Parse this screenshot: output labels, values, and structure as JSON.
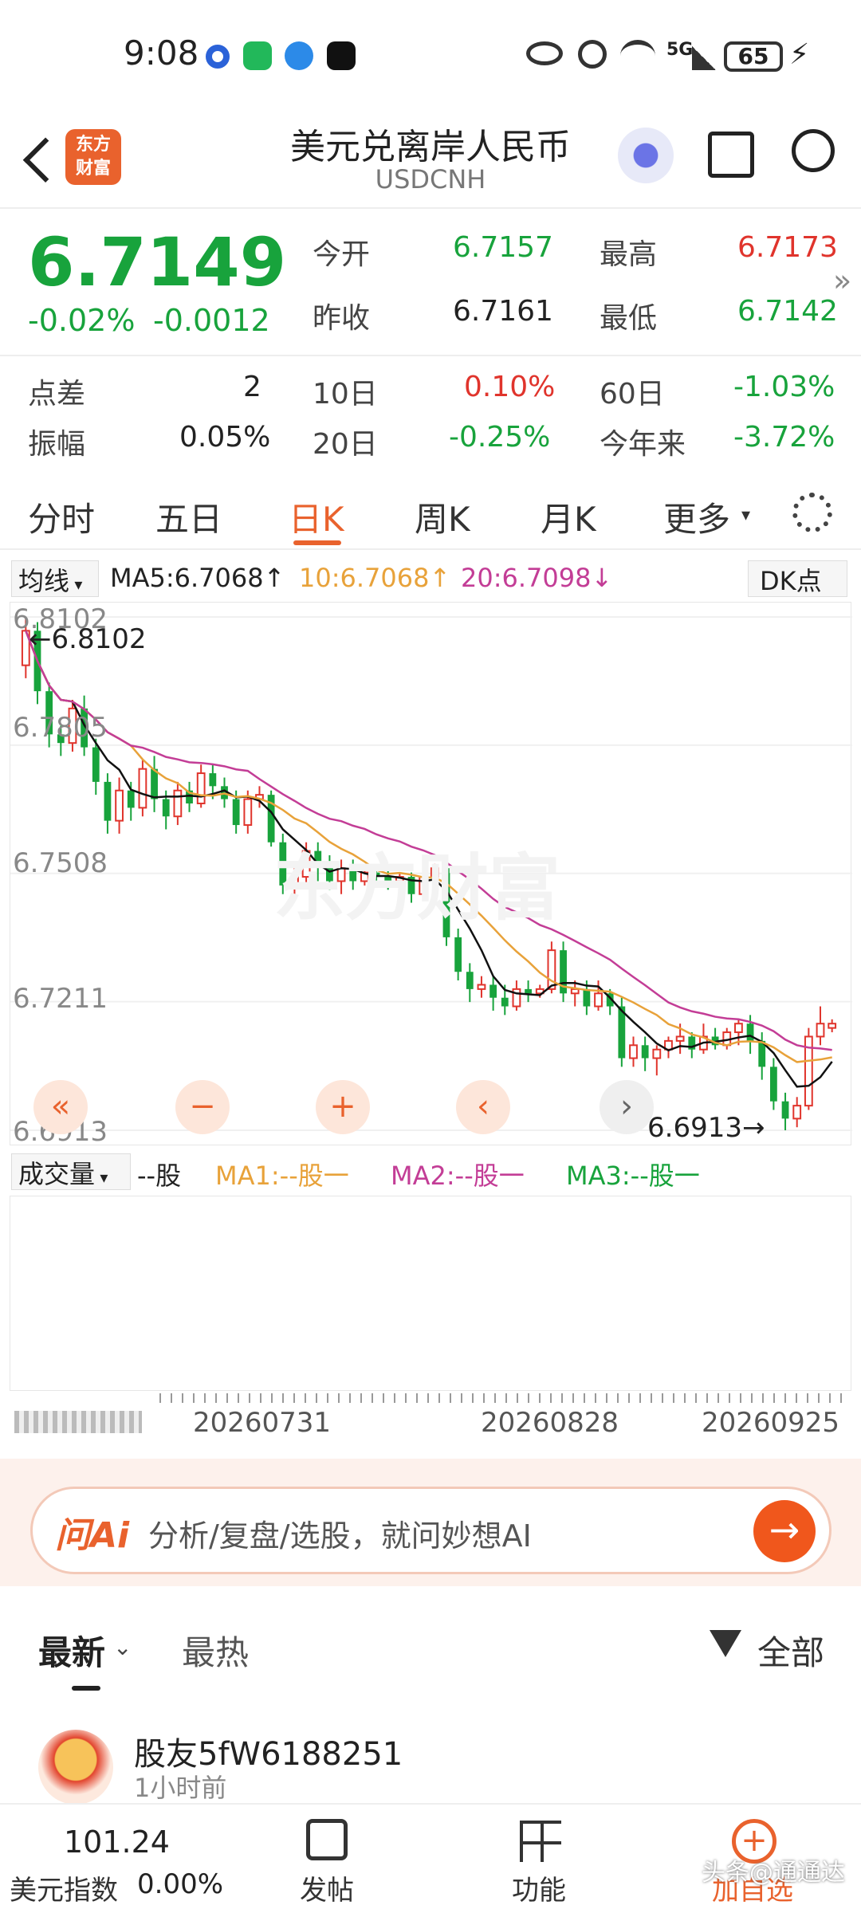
{
  "status": {
    "time": "9:08",
    "battery": "65"
  },
  "nav": {
    "title": "美元兑离岸人民币",
    "subtitle": "USDCNH",
    "logo_line1": "东方",
    "logo_line2": "财富"
  },
  "quote": {
    "price": "6.7149",
    "change_pct": "-0.02%",
    "change": "-0.0012",
    "open_label": "今开",
    "open": "6.7157",
    "high_label": "最高",
    "high": "6.7173",
    "prev_label": "昨收",
    "prev": "6.7161",
    "low_label": "最低",
    "low": "6.7142",
    "spread_label": "点差",
    "spread": "2",
    "d10_label": "10日",
    "d10": "0.10%",
    "d60_label": "60日",
    "d60": "-1.03%",
    "amp_label": "振幅",
    "amp": "0.05%",
    "d20_label": "20日",
    "d20": "-0.25%",
    "ytd_label": "今年来",
    "ytd": "-3.72%"
  },
  "tabs": {
    "t1": "分时",
    "t2": "五日",
    "t3": "日K",
    "t4": "周K",
    "t5": "月K",
    "t6": "更多"
  },
  "legend": {
    "type": "均线",
    "ma5": "MA5:6.7068↑",
    "ma10": "10:6.7068↑",
    "ma20": "20:6.7098↓",
    "dk": "DK点",
    "vol": "成交量",
    "vol_unit": "--股",
    "vol_ma1": "MA1:--股一",
    "vol_ma2": "MA2:--股一",
    "vol_ma3": "MA3:--股一"
  },
  "chart_data": {
    "type": "candlestick",
    "y_ticks": [
      "6.8102",
      "6.7805",
      "6.7508",
      "6.7211",
      "6.6913"
    ],
    "ylim": [
      6.6913,
      6.8102
    ],
    "annotations": {
      "max": "6.8102",
      "min": "6.6913"
    },
    "x_labels": [
      "20260731",
      "20260828",
      "20260925"
    ],
    "colors": {
      "up": "#e0342c",
      "down": "#18a33c",
      "ma5": "#111111",
      "ma10": "#e8a23a",
      "ma20": "#c33d96"
    },
    "candles": [
      [
        6.799,
        6.807,
        6.81,
        6.796
      ],
      [
        6.807,
        6.793,
        6.809,
        6.79
      ],
      [
        6.793,
        6.783,
        6.795,
        6.78
      ],
      [
        6.783,
        6.781,
        6.785,
        6.778
      ],
      [
        6.781,
        6.789,
        6.791,
        6.779
      ],
      [
        6.789,
        6.78,
        6.792,
        6.778
      ],
      [
        6.78,
        6.772,
        6.782,
        6.769
      ],
      [
        6.772,
        6.763,
        6.774,
        6.76
      ],
      [
        6.763,
        6.77,
        6.773,
        6.76
      ],
      [
        6.77,
        6.766,
        6.772,
        6.763
      ],
      [
        6.766,
        6.775,
        6.777,
        6.764
      ],
      [
        6.775,
        6.768,
        6.778,
        6.765
      ],
      [
        6.768,
        6.764,
        6.77,
        6.761
      ],
      [
        6.764,
        6.77,
        6.772,
        6.762
      ],
      [
        6.77,
        6.767,
        6.772,
        6.765
      ],
      [
        6.767,
        6.774,
        6.776,
        6.766
      ],
      [
        6.774,
        6.771,
        6.776,
        6.768
      ],
      [
        6.771,
        6.768,
        6.773,
        6.766
      ],
      [
        6.768,
        6.762,
        6.77,
        6.76
      ],
      [
        6.762,
        6.768,
        6.77,
        6.76
      ],
      [
        6.768,
        6.769,
        6.771,
        6.766
      ],
      [
        6.769,
        6.758,
        6.77,
        6.757
      ],
      [
        6.758,
        6.748,
        6.76,
        6.746
      ],
      [
        6.748,
        6.75,
        6.753,
        6.745
      ],
      [
        6.75,
        6.756,
        6.758,
        6.748
      ],
      [
        6.756,
        6.753,
        6.758,
        6.749
      ],
      [
        6.753,
        6.749,
        6.755,
        6.747
      ],
      [
        6.749,
        6.752,
        6.754,
        6.746
      ],
      [
        6.752,
        6.749,
        6.754,
        6.747
      ],
      [
        6.749,
        6.751,
        6.752,
        6.748
      ],
      [
        6.751,
        6.75,
        6.752,
        6.749
      ],
      [
        6.75,
        6.749,
        6.752,
        6.747
      ],
      [
        6.749,
        6.75,
        6.751,
        6.747
      ],
      [
        6.75,
        6.746,
        6.751,
        6.744
      ],
      [
        6.746,
        6.75,
        6.752,
        6.745
      ],
      [
        6.75,
        6.752,
        6.753,
        6.748
      ],
      [
        6.752,
        6.736,
        6.753,
        6.734
      ],
      [
        6.736,
        6.728,
        6.738,
        6.726
      ],
      [
        6.728,
        6.724,
        6.73,
        6.721
      ],
      [
        6.724,
        6.725,
        6.727,
        6.722
      ],
      [
        6.725,
        6.722,
        6.727,
        6.719
      ],
      [
        6.722,
        6.72,
        6.725,
        6.718
      ],
      [
        6.72,
        6.724,
        6.726,
        6.719
      ],
      [
        6.724,
        6.723,
        6.726,
        6.721
      ],
      [
        6.723,
        6.724,
        6.725,
        6.722
      ],
      [
        6.724,
        6.733,
        6.735,
        6.723
      ],
      [
        6.733,
        6.723,
        6.735,
        6.721
      ],
      [
        6.723,
        6.724,
        6.726,
        6.72
      ],
      [
        6.724,
        6.72,
        6.726,
        6.718
      ],
      [
        6.72,
        6.723,
        6.726,
        6.719
      ],
      [
        6.723,
        6.72,
        6.724,
        6.718
      ],
      [
        6.72,
        6.708,
        6.722,
        6.706
      ],
      [
        6.708,
        6.711,
        6.713,
        6.706
      ],
      [
        6.711,
        6.708,
        6.713,
        6.705
      ],
      [
        6.708,
        6.71,
        6.711,
        6.704
      ],
      [
        6.71,
        6.712,
        6.713,
        6.708
      ],
      [
        6.712,
        6.713,
        6.716,
        6.709
      ],
      [
        6.713,
        6.71,
        6.714,
        6.708
      ],
      [
        6.71,
        6.713,
        6.716,
        6.709
      ],
      [
        6.713,
        6.711,
        6.715,
        6.71
      ],
      [
        6.711,
        6.714,
        6.715,
        6.71
      ],
      [
        6.714,
        6.716,
        6.717,
        6.711
      ],
      [
        6.716,
        6.712,
        6.718,
        6.709
      ],
      [
        6.712,
        6.706,
        6.714,
        6.703
      ],
      [
        6.706,
        6.698,
        6.708,
        6.696
      ],
      [
        6.698,
        6.694,
        6.7,
        6.6913
      ],
      [
        6.694,
        6.697,
        6.699,
        6.692
      ],
      [
        6.697,
        6.713,
        6.715,
        6.696
      ],
      [
        6.713,
        6.716,
        6.72,
        6.711
      ],
      [
        6.715,
        6.716,
        6.717,
        6.714
      ]
    ]
  },
  "ai": {
    "brand": "问Ai",
    "placeholder": "分析/复盘/选股，就问妙想AI"
  },
  "feed": {
    "tab_latest": "最新",
    "tab_hot": "最热",
    "filter": "全部",
    "user": "股友5fW6188251",
    "time": "1小时前"
  },
  "bottom": {
    "index_value": "101.24",
    "index_name": "美元指数",
    "index_change": "0.00%",
    "post": "发帖",
    "func": "功能",
    "add": "加自选",
    "watermark": "头条@通通达"
  }
}
